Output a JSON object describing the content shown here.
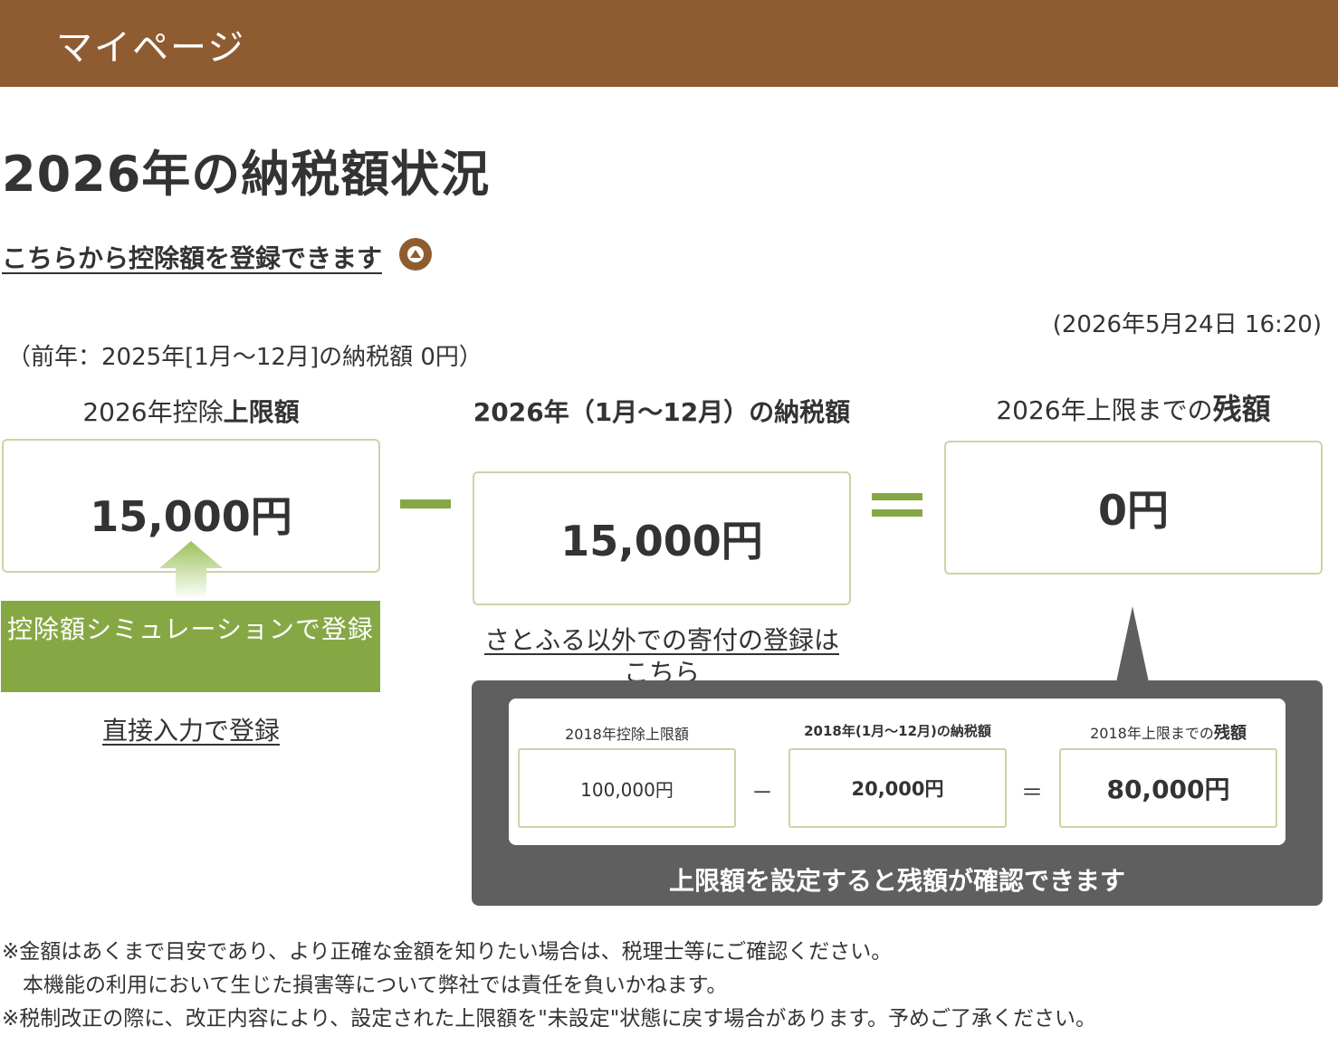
{
  "header": {
    "title": "マイページ",
    "background_color": "#8f5c32"
  },
  "page_title": "2026年の納税額状況",
  "register_link": {
    "label": "こちらから控除額を登録できます",
    "icon": "arrow-up-circle-icon"
  },
  "timestamp": "(2026年5月24日 16:20)",
  "previous_year": "（前年：2025年[1月～12月]の納税額 0円）",
  "summary": {
    "limit": {
      "label_prefix": "2026年控除",
      "label_bold": "上限額",
      "value": "15,000円"
    },
    "tax": {
      "label": "2026年（1月～12月）の納税額",
      "value": "15,000円"
    },
    "remaining": {
      "label_prefix": "2026年上限までの",
      "label_bold": "残額",
      "value": "0円"
    },
    "accent_color": "#86a844"
  },
  "actions": {
    "simulation_button": "控除額シミュレーションで登録",
    "direct_input_link": "直接入力で登録",
    "other_donation_link": "さとふる以外での寄付の登録はこちら"
  },
  "example_tooltip": {
    "limit": {
      "label": "2018年控除上限額",
      "value": "100,000円"
    },
    "tax": {
      "label": "2018年(1月～12月)の納税額",
      "value": "20,000円"
    },
    "remaining": {
      "label_prefix": "2018年上限までの",
      "label_bold": "残額",
      "value": "80,000円"
    },
    "minus": "－",
    "equals": "＝",
    "caption": "上限額を設定すると残額が確認できます"
  },
  "notes": [
    "※金額はあくまで目安であり、より正確な金額を知りたい場合は、税理士等にご確認ください。",
    "　本機能の利用において生じた損害等について弊社では責任を負いかねます。",
    "※税制改正の際に、改正内容により、設定された上限額を\"未設定\"状態に戻す場合があります。予めご了承ください。"
  ]
}
